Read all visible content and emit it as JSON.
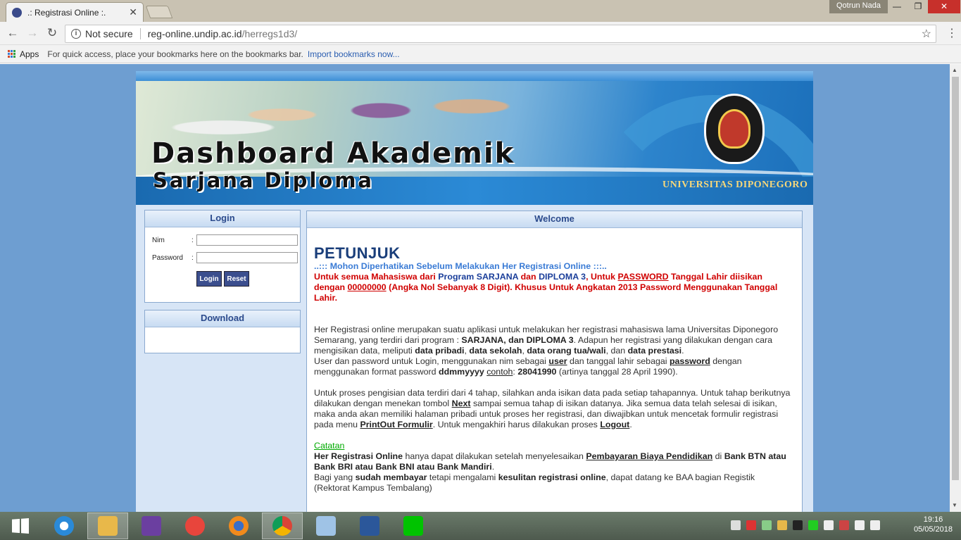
{
  "browser": {
    "tab_title": ".: Registrasi Online :.",
    "user_name": "Qotrun Nada",
    "security_label": "Not secure",
    "url_host": "reg-online.undip.ac.id",
    "url_path": "/herregs1d3/",
    "bookmarks_apps": "Apps",
    "bookmarks_hint": "For quick access, place your bookmarks here on the bookmarks bar.",
    "bookmarks_import": "Import bookmarks now..."
  },
  "banner": {
    "title_line1": "Dashboard Akademik",
    "title_line2": "Sarjana Diploma",
    "university": "UNIVERSITAS DIPONEGORO"
  },
  "login": {
    "heading": "Login",
    "nim_label": "Nim",
    "password_label": "Password",
    "colon": ":",
    "login_button": "Login",
    "reset_button": "Reset"
  },
  "download": {
    "heading": "Download"
  },
  "welcome": {
    "heading": "Welcome",
    "title": "PETUNJUK",
    "subtitle": "..::: Mohon Diperhatikan Sebelum Melakukan Her Registrasi Online :::..",
    "warn_1": "Untuk semua Mahasiswa dari ",
    "warn_program": "Program SARJANA",
    "warn_2": " dan ",
    "warn_d3": "DIPLOMA 3",
    "warn_3": ", Untuk ",
    "warn_pw": "PASSWORD",
    "warn_4": " Tanggal Lahir diisikan dengan ",
    "warn_zeros": "00000000",
    "warn_5": " (Angka Nol Sebanyak 8 Digit). Khusus Untuk Angkatan 2013 Password Menggunakan Tanggal Lahir.",
    "p1_a": "Her Registrasi online merupakan suatu aplikasi untuk melakukan her registrasi mahasiswa lama Universitas Diponegoro Semarang, yang terdiri dari program : ",
    "p1_b": "SARJANA, dan DIPLOMA 3",
    "p1_c": ". Adapun her registrasi yang dilakukan dengan cara mengisikan data, meliputi ",
    "p1_d": "data pribadi",
    "p1_e": ", ",
    "p1_f": "data sekolah",
    "p1_g": ", ",
    "p1_h": "data orang tua/wali",
    "p1_i": ", dan ",
    "p1_j": "data prestasi",
    "p1_k": ".",
    "p2_a": "User dan password untuk Login, menggunakan nim sebagai ",
    "p2_user": "user",
    "p2_b": " dan tanggal lahir sebagai ",
    "p2_pw": "password",
    "p2_c": " dengan menggunakan format password ",
    "p2_fmt": "ddmmyyyy",
    "p2_d": " ",
    "p2_contoh": "contoh",
    "p2_e": ": ",
    "p2_ex": "28041990",
    "p2_f": " (artinya tanggal 28 April 1990).",
    "p3_a": "Untuk proses pengisian data terdiri dari 4 tahap, silahkan anda isikan data pada setiap tahapannya. Untuk tahap berikutnya dilakukan dengan menekan tombol ",
    "p3_next": "Next",
    "p3_b": " sampai semua tahap di isikan datanya. Jika semua data telah selesai di isikan, maka anda akan memiliki halaman pribadi untuk proses her registrasi, dan diwajibkan untuk mencetak formulir registrasi pada menu ",
    "p3_print": "PrintOut Formulir",
    "p3_c": ". Untuk mengakhiri harus dilakukan proses ",
    "p3_logout": "Logout",
    "p3_d": ".",
    "catatan": "Catatan",
    "c1_a": "Her Registrasi Online",
    "c1_b": " hanya dapat dilakukan setelah menyelesaikan ",
    "c1_c": "Pembayaran Biaya Pendidikan",
    "c1_d": " di ",
    "c1_e": "Bank BTN atau Bank BRI atau Bank BNI atau Bank Mandiri",
    "c1_f": ".",
    "c2_a": "Bagi yang ",
    "c2_b": "sudah membayar",
    "c2_c": " tetapi mengalami ",
    "c2_d": "kesulitan registrasi online",
    "c2_e": ", dapat datang ke BAA bagian Registik (Rektorat Kampus Tembalang)"
  },
  "taskbar": {
    "time": "19:16",
    "date": "05/05/2018",
    "apps": [
      "start-icon",
      "internet-explorer-icon",
      "file-explorer-icon",
      "visual-studio-icon",
      "app-icon",
      "firefox-icon",
      "chrome-icon",
      "computer-icon",
      "word-icon",
      "line-icon"
    ]
  }
}
